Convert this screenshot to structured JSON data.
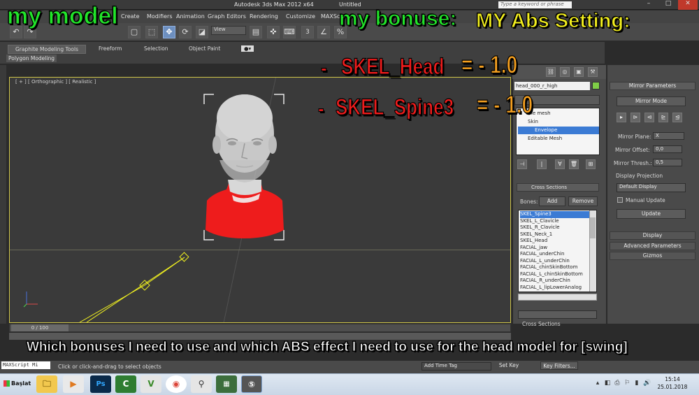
{
  "titlebar": {
    "app_title": "Autodesk 3ds Max  2012 x64",
    "doc_title": "Untitled",
    "search_placeholder": "Type a keyword or phrase"
  },
  "menu": {
    "items": [
      "Create",
      "Modifiers",
      "Animation",
      "Graph Editors",
      "Rendering",
      "Customize",
      "MAXSc"
    ]
  },
  "toolbar": {
    "view_select": "View",
    "snap_value": "3"
  },
  "ribbon": {
    "tabs": [
      "Graphite Modeling Tools",
      "Freeform",
      "Selection",
      "Object Paint"
    ],
    "subtab": "Polygon Modeling"
  },
  "viewport": {
    "label": "[ + ] [ Orthographic ] [ Realistic ]"
  },
  "command_panel": {
    "object_name": "head_000_r_high",
    "stack": [
      "me mesh",
      "Skin",
      "Envelope",
      "Editable Mesh"
    ],
    "cross_sections_label": "Cross Sections",
    "bones_label": "Bones:",
    "add_label": "Add",
    "remove_label": "Remove",
    "bones": [
      "SKEL_Spine3",
      "SKEL_L_Clavicle",
      "SKEL_R_Clavicle",
      "SKEL_Neck_1",
      "SKEL_Head",
      "FACIAL_jaw",
      "FACIAL_underChin",
      "FACIAL_L_underChin",
      "FACIAL_chinSkinBottom",
      "FACIAL_L_chinSkinBottom",
      "FACIAL_R_underChin",
      "FACIAL_L_lipLowerAnalog"
    ],
    "selected_bone_index": 0,
    "cross_sections_bottom": "Cross Sections",
    "add2": "Add",
    "remove2": "Remove"
  },
  "mirror": {
    "header": "Mirror Parameters",
    "mode_btn": "Mirror Mode",
    "plane_label": "Mirror Plane:",
    "plane_value": "X",
    "offset_label": "Mirror Offset:",
    "offset_value": "0,0",
    "thresh_label": "Mirror Thresh.:",
    "thresh_value": "0,5",
    "display_proj_label": "Display Projection",
    "display_proj_value": "Default Display",
    "manual_update": "Manual Update",
    "update_btn": "Update",
    "rollouts": [
      "Display",
      "Advanced Parameters",
      "Gizmos"
    ]
  },
  "timeline": {
    "frame": "0 / 100"
  },
  "status": {
    "maxscript": "MAXScript Mi",
    "prompt": "Click or click-and-drag to select objects",
    "add_time_tag": "Add Time Tag",
    "set_key": "Set Key",
    "key_filters": "Key Filters..."
  },
  "taskbar": {
    "start": "Başlat",
    "time": "15:14",
    "date": "25.01.2018"
  },
  "overlay": {
    "my_model": "my model",
    "my_bonuse": "my bonuse:",
    "abs_setting": "MY Abs Setting:",
    "dash1": "-",
    "bone1": "SKEL_Head",
    "eq1": "= - 1.0",
    "dash2": "-",
    "bone2": "SKEL_Spine3",
    "eq2": "= - 1.0",
    "caption": "Which bonuses I need to use and which ABS effect I need to use for the head model for [swing]"
  },
  "colors": {
    "highlight": "#3b7bd4",
    "object_color": "#7fce47",
    "viewport_border": "#d0c64a",
    "weight_red": "#ee1c1c"
  }
}
